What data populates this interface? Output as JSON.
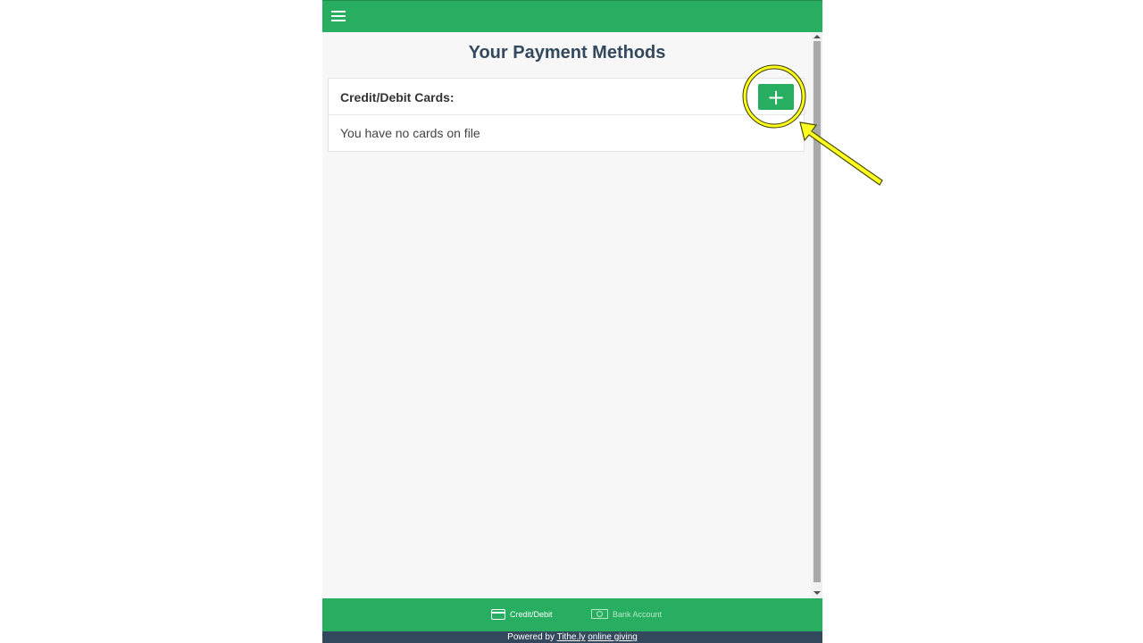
{
  "header": {
    "menu_icon": "hamburger-menu-icon",
    "color": "#27ae60"
  },
  "main": {
    "title": "Your Payment Methods",
    "cards_panel": {
      "title": "Credit/Debit Cards:",
      "add_label": "+",
      "empty_text": "You have no cards on file"
    }
  },
  "bottom_nav": {
    "items": [
      {
        "label": "Credit/Debit",
        "icon": "credit-card-icon",
        "active": true
      },
      {
        "label": "Bank Account",
        "icon": "banknote-icon",
        "active": false
      }
    ]
  },
  "footer": {
    "prefix": "Powered by",
    "link1": "Tithe.ly",
    "link2": "online giving"
  },
  "colors": {
    "accent": "#27ae60",
    "title": "#34495e",
    "footer_bg": "#34495e",
    "highlight": "#ffff1f"
  }
}
